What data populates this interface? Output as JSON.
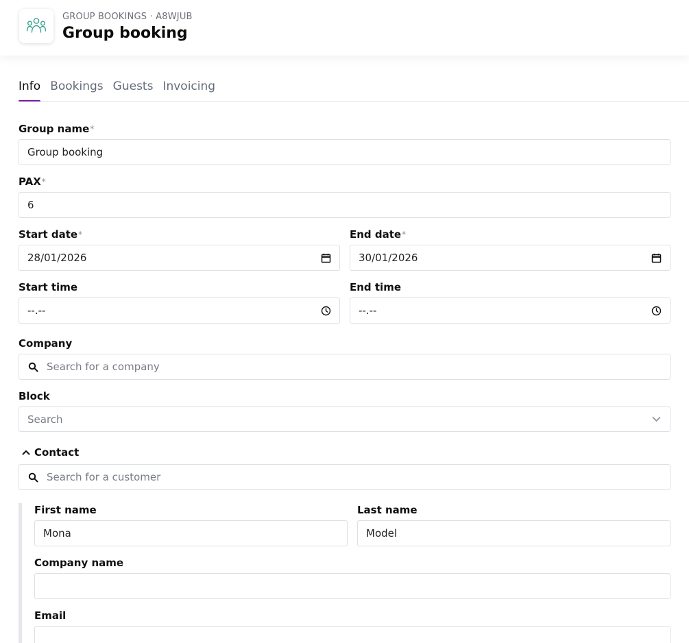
{
  "header": {
    "breadcrumb": "GROUP BOOKINGS · A8WJUB",
    "title": "Group booking",
    "icon": "group-people-icon",
    "icon_color": "#3aa48c"
  },
  "tabs": [
    {
      "label": "Info",
      "active": true
    },
    {
      "label": "Bookings",
      "active": false
    },
    {
      "label": "Guests",
      "active": false
    },
    {
      "label": "Invoicing",
      "active": false
    }
  ],
  "accent_color": "#7a1fa2",
  "required_marker": "*",
  "form": {
    "group_name": {
      "label": "Group name",
      "value": "Group booking"
    },
    "pax": {
      "label": "PAX",
      "value": "6"
    },
    "start_date": {
      "label": "Start date",
      "value": "28/01/2026"
    },
    "end_date": {
      "label": "End date",
      "value": "30/01/2026"
    },
    "start_time": {
      "label": "Start time",
      "value": "--.--"
    },
    "end_time": {
      "label": "End time",
      "value": "--.--"
    },
    "company": {
      "label": "Company",
      "placeholder": "Search for a company"
    },
    "block": {
      "label": "Block",
      "placeholder": "Search"
    },
    "contact": {
      "label": "Contact",
      "search_placeholder": "Search for a customer",
      "first_name": {
        "label": "First name",
        "value": "Mona"
      },
      "last_name": {
        "label": "Last name",
        "value": "Model"
      },
      "company_name": {
        "label": "Company name",
        "value": ""
      },
      "email": {
        "label": "Email",
        "value": ""
      }
    }
  }
}
